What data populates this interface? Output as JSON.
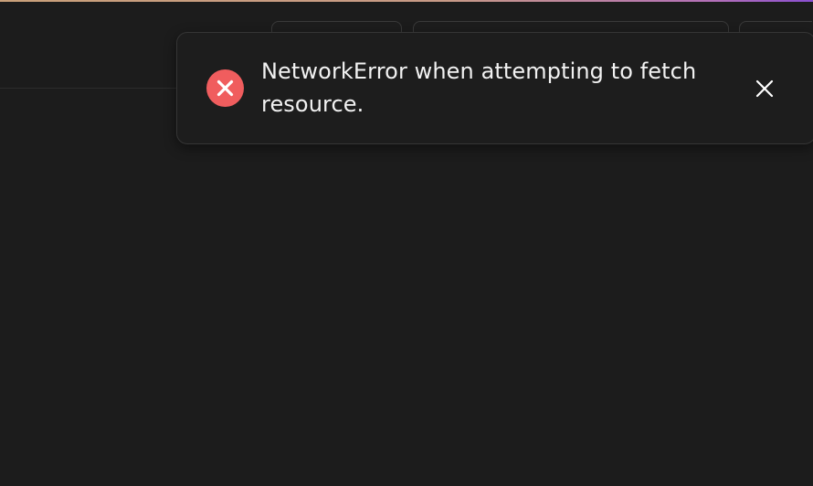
{
  "toast": {
    "message": "NetworkError when attempting to fetch resource.",
    "icon": "error-icon",
    "close_icon": "close-icon",
    "error_color": "#f05d5e"
  },
  "theme": {
    "background": "#1c1c1c",
    "accent_gradient": [
      "#c9a07a",
      "#b26fb8",
      "#8a4fd0"
    ]
  }
}
